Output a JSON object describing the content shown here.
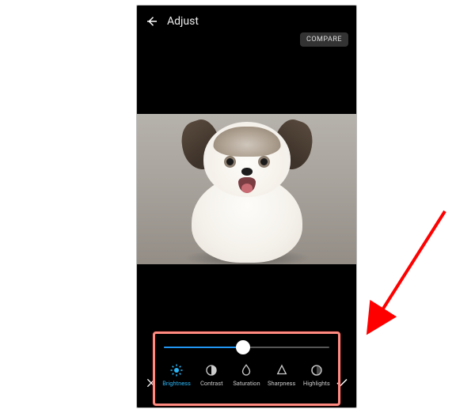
{
  "header": {
    "title": "Adjust",
    "compare_label": "COMPARE"
  },
  "slider": {
    "percent": 48,
    "accent": "#2196f3"
  },
  "tools": [
    {
      "name": "brightness",
      "label": "Brightness",
      "active": true
    },
    {
      "name": "contrast",
      "label": "Contrast",
      "active": false
    },
    {
      "name": "saturation",
      "label": "Saturation",
      "active": false
    },
    {
      "name": "sharpness",
      "label": "Sharpness",
      "active": false
    },
    {
      "name": "highlights",
      "label": "Highlights",
      "active": false
    }
  ],
  "annotation": {
    "highlight_color": "#ff8a80",
    "arrow_color": "#ff0000"
  }
}
